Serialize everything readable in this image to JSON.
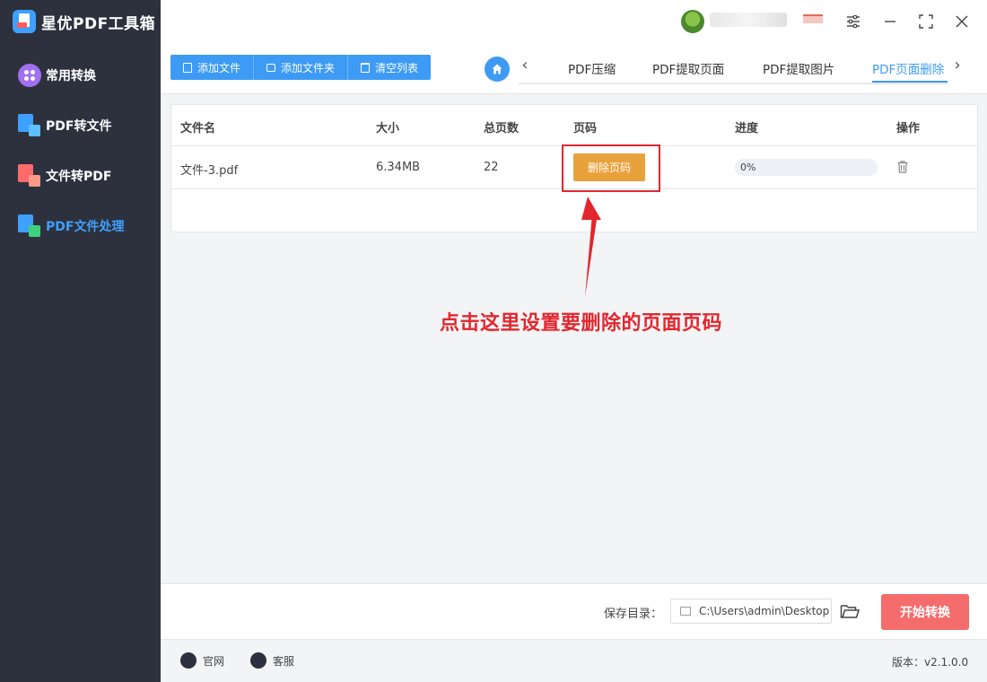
{
  "app": {
    "title": "星优PDF工具箱"
  },
  "sidebar": {
    "items": [
      {
        "label": "常用转换"
      },
      {
        "label": "PDF转文件"
      },
      {
        "label": "文件转PDF"
      },
      {
        "label": "PDF文件处理",
        "active": true
      }
    ]
  },
  "toolbar": {
    "add_file": "添加文件",
    "add_folder": "添加文件夹",
    "clear_list": "清空列表"
  },
  "tabs": [
    {
      "label": "PDF压缩"
    },
    {
      "label": "PDF提取页面"
    },
    {
      "label": "PDF提取图片"
    },
    {
      "label": "PDF页面删除",
      "active": true
    }
  ],
  "table": {
    "headers": {
      "name": "文件名",
      "size": "大小",
      "pages": "总页数",
      "pagecode": "页码",
      "progress": "进度",
      "action": "操作"
    },
    "rows": [
      {
        "name": "文件-3.pdf",
        "size": "6.34MB",
        "pages": "22",
        "button": "删除页码",
        "progress": 0,
        "progress_text": "0%"
      }
    ]
  },
  "annotation": {
    "text": "点击这里设置要删除的页面页码"
  },
  "bottom": {
    "save_label": "保存目录：",
    "save_path": "C:\\Users\\admin\\Desktop",
    "start_button": "开始转换"
  },
  "footer": {
    "website": "官网",
    "service": "客服",
    "version": "版本：v2.1.0.0"
  },
  "colors": {
    "accent": "#3d9bf5",
    "sidebar_bg": "#2d313d",
    "delete_btn": "#e9a23b",
    "start_btn": "#f56c6c",
    "annotation": "#e3262e"
  }
}
